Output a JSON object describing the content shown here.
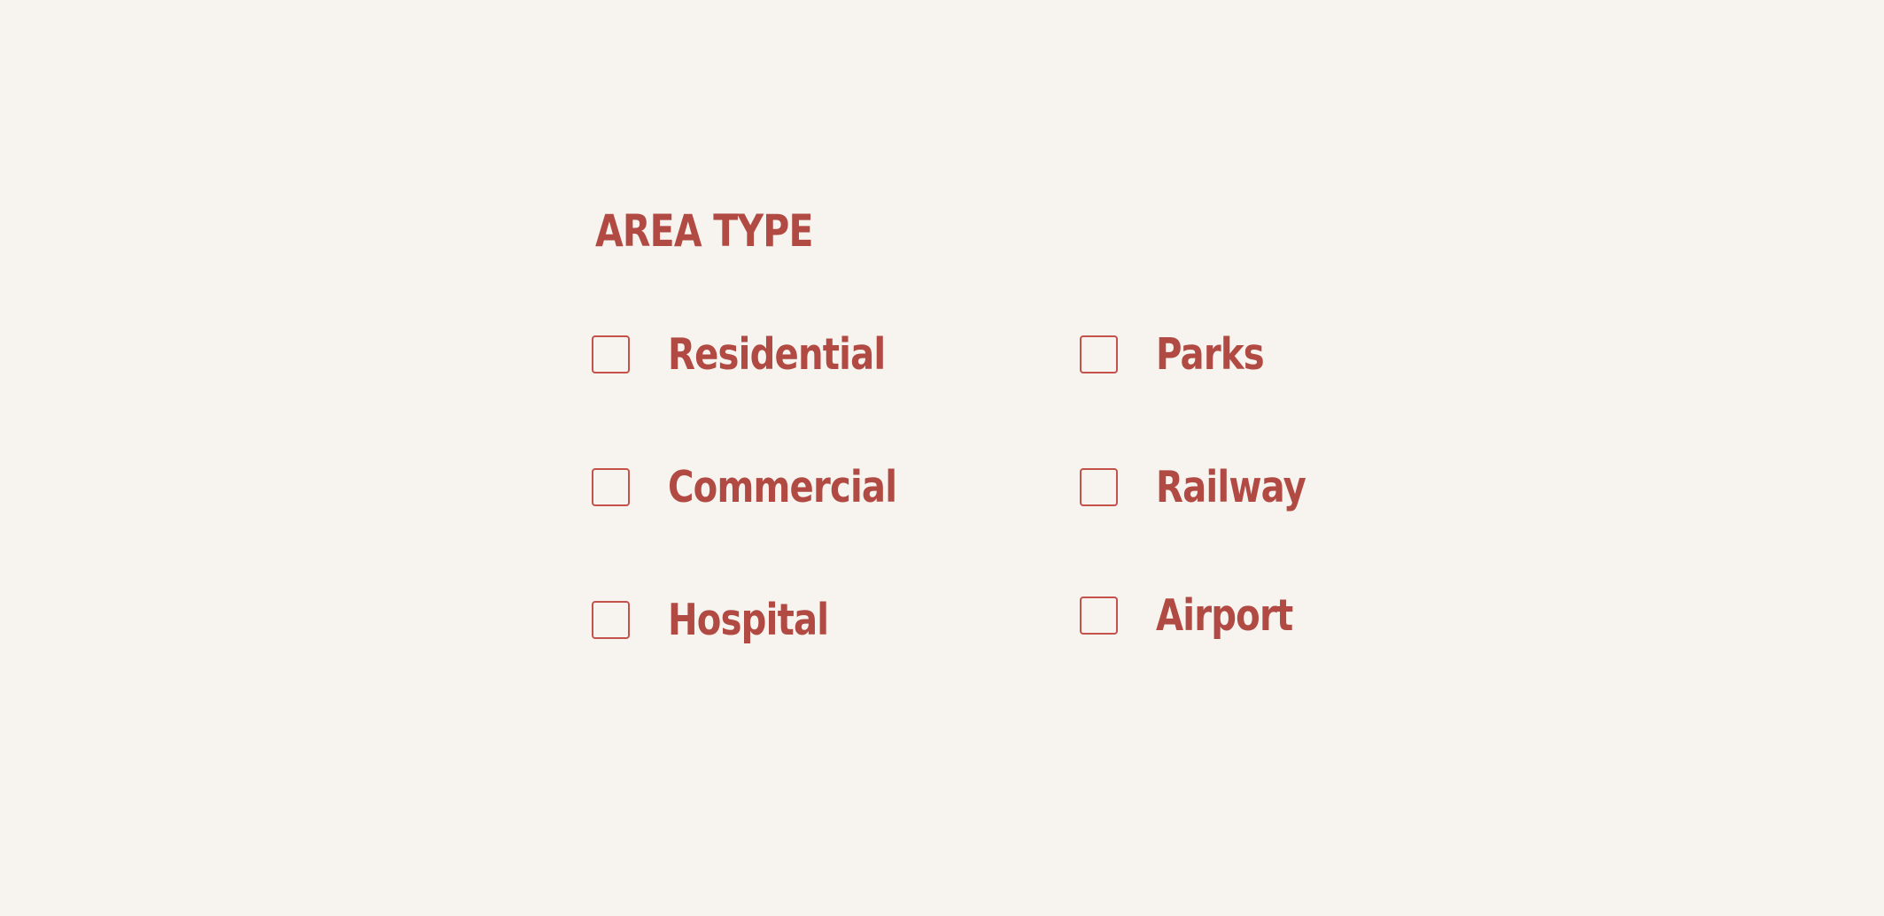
{
  "filter": {
    "title": "AREA TYPE",
    "options": [
      {
        "label": "Residential",
        "checked": false
      },
      {
        "label": "Commercial",
        "checked": false
      },
      {
        "label": "Hospital",
        "checked": false
      },
      {
        "label": "Parks",
        "checked": false
      },
      {
        "label": "Railway",
        "checked": false
      },
      {
        "label": "Airport",
        "checked": false
      }
    ]
  },
  "colors": {
    "background": "#f7f3ef",
    "accent": "#b04a42",
    "checkbox_border": "#c4524a"
  }
}
